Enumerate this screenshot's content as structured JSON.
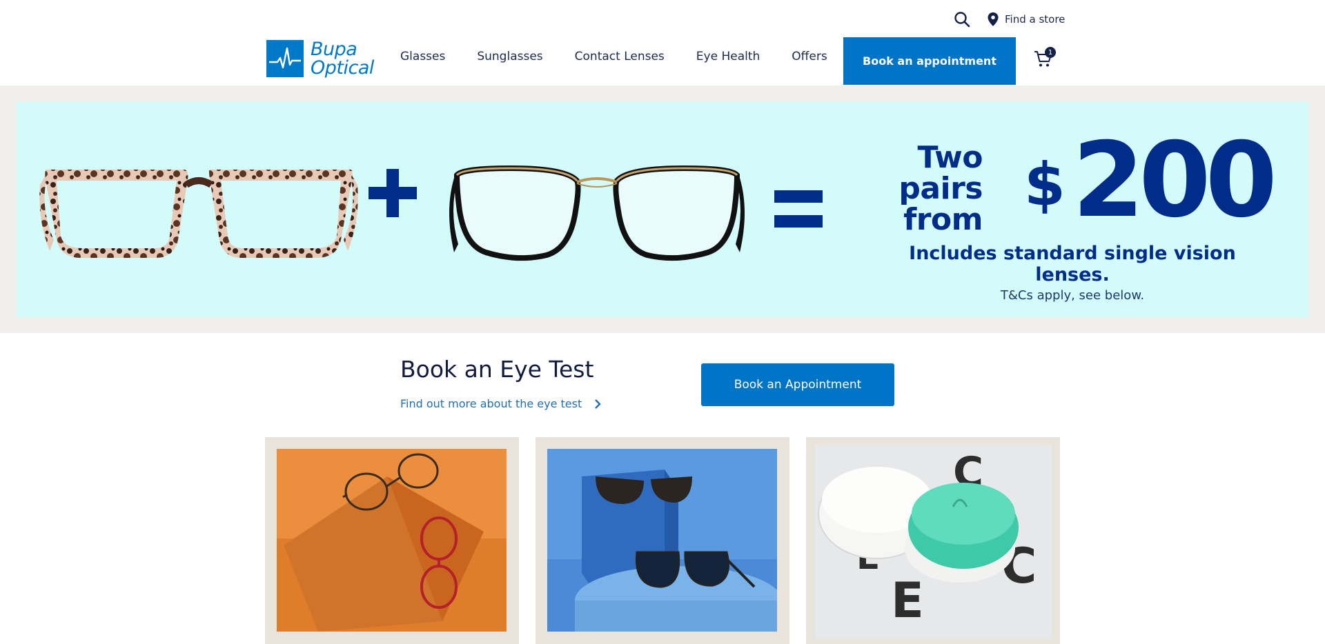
{
  "header": {
    "find_store": "Find a store",
    "logo_line1": "Bupa",
    "logo_line2": "Optical",
    "nav": [
      "Glasses",
      "Sunglasses",
      "Contact Lenses",
      "Eye Health",
      "Offers"
    ],
    "book_button": "Book an appointment",
    "cart_count": "1"
  },
  "hero": {
    "pairs_line1": "Two pairs",
    "pairs_line2": "from",
    "currency": "$",
    "price": "200",
    "lenses_text": "Includes standard single vision lenses.",
    "tcs_text": "T&Cs apply, see below."
  },
  "eye_test": {
    "title": "Book an Eye Test",
    "link": "Find out more about the eye test",
    "button": "Book an Appointment"
  },
  "colors": {
    "brand_blue": "#0074c7",
    "navy": "#002d8a",
    "hero_bg": "#d2fbfa"
  }
}
